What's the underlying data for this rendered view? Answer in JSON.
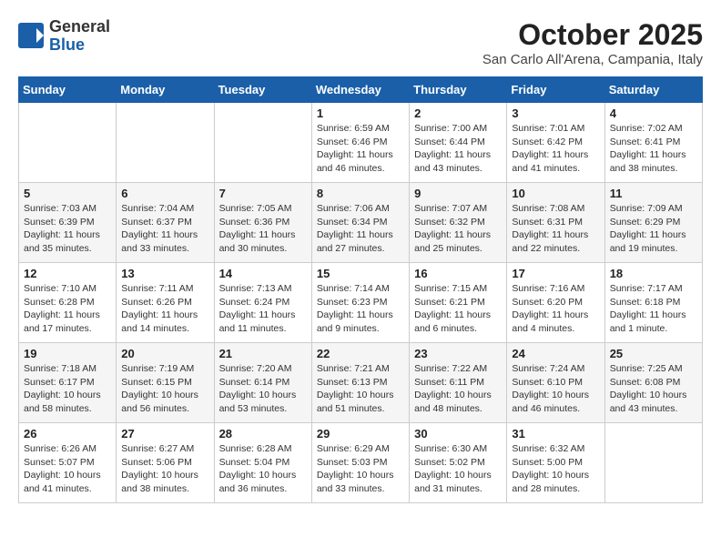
{
  "header": {
    "logo_general": "General",
    "logo_blue": "Blue",
    "month_title": "October 2025",
    "location": "San Carlo All'Arena, Campania, Italy"
  },
  "days_of_week": [
    "Sunday",
    "Monday",
    "Tuesday",
    "Wednesday",
    "Thursday",
    "Friday",
    "Saturday"
  ],
  "weeks": [
    [
      {
        "day": "",
        "info": ""
      },
      {
        "day": "",
        "info": ""
      },
      {
        "day": "",
        "info": ""
      },
      {
        "day": "1",
        "info": "Sunrise: 6:59 AM\nSunset: 6:46 PM\nDaylight: 11 hours and 46 minutes."
      },
      {
        "day": "2",
        "info": "Sunrise: 7:00 AM\nSunset: 6:44 PM\nDaylight: 11 hours and 43 minutes."
      },
      {
        "day": "3",
        "info": "Sunrise: 7:01 AM\nSunset: 6:42 PM\nDaylight: 11 hours and 41 minutes."
      },
      {
        "day": "4",
        "info": "Sunrise: 7:02 AM\nSunset: 6:41 PM\nDaylight: 11 hours and 38 minutes."
      }
    ],
    [
      {
        "day": "5",
        "info": "Sunrise: 7:03 AM\nSunset: 6:39 PM\nDaylight: 11 hours and 35 minutes."
      },
      {
        "day": "6",
        "info": "Sunrise: 7:04 AM\nSunset: 6:37 PM\nDaylight: 11 hours and 33 minutes."
      },
      {
        "day": "7",
        "info": "Sunrise: 7:05 AM\nSunset: 6:36 PM\nDaylight: 11 hours and 30 minutes."
      },
      {
        "day": "8",
        "info": "Sunrise: 7:06 AM\nSunset: 6:34 PM\nDaylight: 11 hours and 27 minutes."
      },
      {
        "day": "9",
        "info": "Sunrise: 7:07 AM\nSunset: 6:32 PM\nDaylight: 11 hours and 25 minutes."
      },
      {
        "day": "10",
        "info": "Sunrise: 7:08 AM\nSunset: 6:31 PM\nDaylight: 11 hours and 22 minutes."
      },
      {
        "day": "11",
        "info": "Sunrise: 7:09 AM\nSunset: 6:29 PM\nDaylight: 11 hours and 19 minutes."
      }
    ],
    [
      {
        "day": "12",
        "info": "Sunrise: 7:10 AM\nSunset: 6:28 PM\nDaylight: 11 hours and 17 minutes."
      },
      {
        "day": "13",
        "info": "Sunrise: 7:11 AM\nSunset: 6:26 PM\nDaylight: 11 hours and 14 minutes."
      },
      {
        "day": "14",
        "info": "Sunrise: 7:13 AM\nSunset: 6:24 PM\nDaylight: 11 hours and 11 minutes."
      },
      {
        "day": "15",
        "info": "Sunrise: 7:14 AM\nSunset: 6:23 PM\nDaylight: 11 hours and 9 minutes."
      },
      {
        "day": "16",
        "info": "Sunrise: 7:15 AM\nSunset: 6:21 PM\nDaylight: 11 hours and 6 minutes."
      },
      {
        "day": "17",
        "info": "Sunrise: 7:16 AM\nSunset: 6:20 PM\nDaylight: 11 hours and 4 minutes."
      },
      {
        "day": "18",
        "info": "Sunrise: 7:17 AM\nSunset: 6:18 PM\nDaylight: 11 hours and 1 minute."
      }
    ],
    [
      {
        "day": "19",
        "info": "Sunrise: 7:18 AM\nSunset: 6:17 PM\nDaylight: 10 hours and 58 minutes."
      },
      {
        "day": "20",
        "info": "Sunrise: 7:19 AM\nSunset: 6:15 PM\nDaylight: 10 hours and 56 minutes."
      },
      {
        "day": "21",
        "info": "Sunrise: 7:20 AM\nSunset: 6:14 PM\nDaylight: 10 hours and 53 minutes."
      },
      {
        "day": "22",
        "info": "Sunrise: 7:21 AM\nSunset: 6:13 PM\nDaylight: 10 hours and 51 minutes."
      },
      {
        "day": "23",
        "info": "Sunrise: 7:22 AM\nSunset: 6:11 PM\nDaylight: 10 hours and 48 minutes."
      },
      {
        "day": "24",
        "info": "Sunrise: 7:24 AM\nSunset: 6:10 PM\nDaylight: 10 hours and 46 minutes."
      },
      {
        "day": "25",
        "info": "Sunrise: 7:25 AM\nSunset: 6:08 PM\nDaylight: 10 hours and 43 minutes."
      }
    ],
    [
      {
        "day": "26",
        "info": "Sunrise: 6:26 AM\nSunset: 5:07 PM\nDaylight: 10 hours and 41 minutes."
      },
      {
        "day": "27",
        "info": "Sunrise: 6:27 AM\nSunset: 5:06 PM\nDaylight: 10 hours and 38 minutes."
      },
      {
        "day": "28",
        "info": "Sunrise: 6:28 AM\nSunset: 5:04 PM\nDaylight: 10 hours and 36 minutes."
      },
      {
        "day": "29",
        "info": "Sunrise: 6:29 AM\nSunset: 5:03 PM\nDaylight: 10 hours and 33 minutes."
      },
      {
        "day": "30",
        "info": "Sunrise: 6:30 AM\nSunset: 5:02 PM\nDaylight: 10 hours and 31 minutes."
      },
      {
        "day": "31",
        "info": "Sunrise: 6:32 AM\nSunset: 5:00 PM\nDaylight: 10 hours and 28 minutes."
      },
      {
        "day": "",
        "info": ""
      }
    ]
  ]
}
